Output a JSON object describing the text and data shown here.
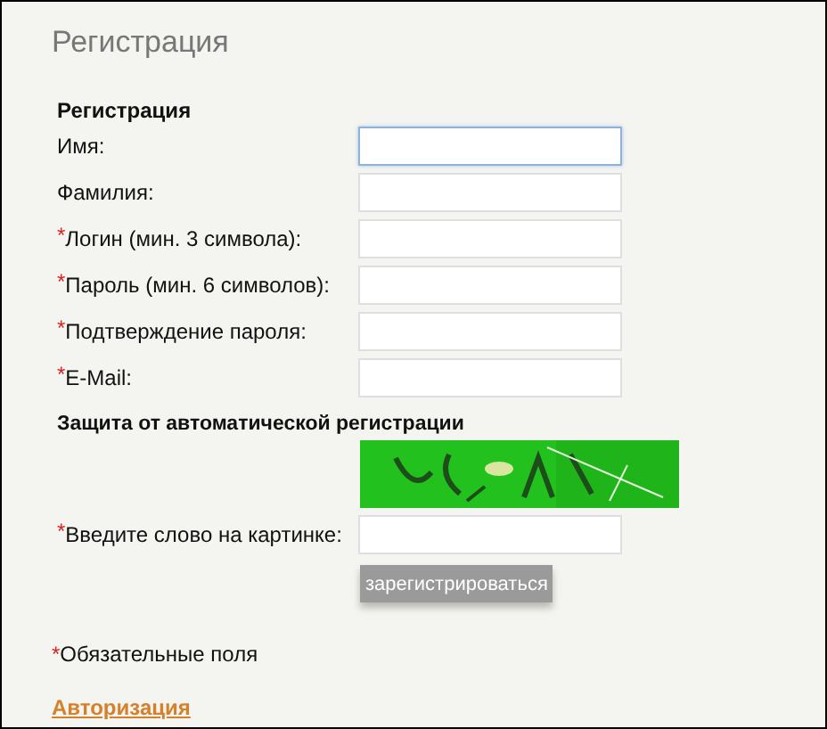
{
  "page_title": "Регистрация",
  "form": {
    "heading": "Регистрация",
    "required_marker": "*",
    "fields": [
      {
        "label": "Имя:",
        "required": false,
        "focused": true
      },
      {
        "label": "Фамилия:",
        "required": false,
        "focused": false
      },
      {
        "label": "Логин (мин. 3 символа):",
        "required": true,
        "focused": false
      },
      {
        "label": "Пароль (мин. 6 символов):",
        "required": true,
        "focused": false
      },
      {
        "label": "Подтверждение пароля:",
        "required": true,
        "focused": false
      },
      {
        "label": "E-Mail:",
        "required": true,
        "focused": false
      }
    ],
    "captcha": {
      "heading": "Защита от автоматической регистрации",
      "label": "Введите слово на картинке:",
      "required": true,
      "focused": false
    },
    "submit_button": "зарегистрироваться"
  },
  "required_note": {
    "marker": "*",
    "text": "Обязательные поля"
  },
  "login_link": "Авторизация"
}
